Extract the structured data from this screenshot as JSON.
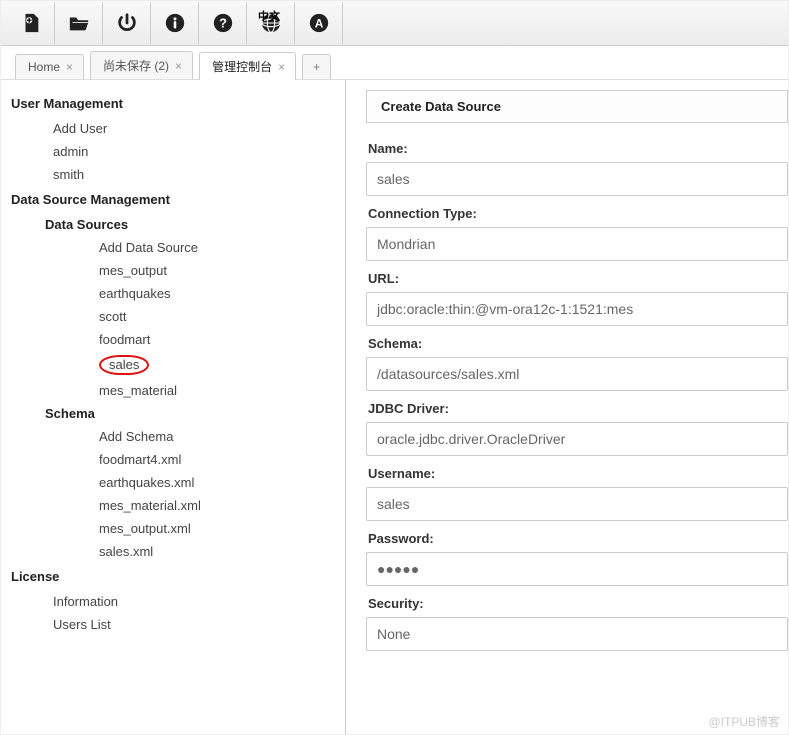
{
  "toolbar": {
    "lang_overlay": "中文"
  },
  "tabs": [
    {
      "label": "Home",
      "active": false
    },
    {
      "label": "尚未保存 (2)",
      "active": false
    },
    {
      "label": "管理控制台",
      "active": true
    }
  ],
  "sidebar": {
    "user_mgmt": {
      "title": "User Management",
      "items": [
        "Add User",
        "admin",
        "smith"
      ]
    },
    "ds_mgmt": {
      "title": "Data Source Management",
      "data_sources": {
        "title": "Data Sources",
        "items": [
          "Add Data Source",
          "mes_output",
          "earthquakes",
          "scott",
          "foodmart",
          "sales",
          "mes_material"
        ],
        "selected_index": 5
      },
      "schema": {
        "title": "Schema",
        "items": [
          "Add Schema",
          "foodmart4.xml",
          "earthquakes.xml",
          "mes_material.xml",
          "mes_output.xml",
          "sales.xml"
        ]
      }
    },
    "license": {
      "title": "License",
      "items": [
        "Information",
        "Users List"
      ]
    }
  },
  "content": {
    "header": "Create Data Source",
    "fields": {
      "name": {
        "label": "Name:",
        "value": "sales"
      },
      "conntype": {
        "label": "Connection Type:",
        "value": "Mondrian"
      },
      "url": {
        "label": "URL:",
        "value": "jdbc:oracle:thin:@vm-ora12c-1:1521:mes"
      },
      "schema": {
        "label": "Schema:",
        "value": "/datasources/sales.xml"
      },
      "driver": {
        "label": "JDBC Driver:",
        "value": "oracle.jdbc.driver.OracleDriver"
      },
      "username": {
        "label": "Username:",
        "value": "sales"
      },
      "password": {
        "label": "Password:",
        "value": "●●●●●"
      },
      "security": {
        "label": "Security:",
        "value": "None"
      }
    }
  },
  "watermark": "@ITPUB博客"
}
